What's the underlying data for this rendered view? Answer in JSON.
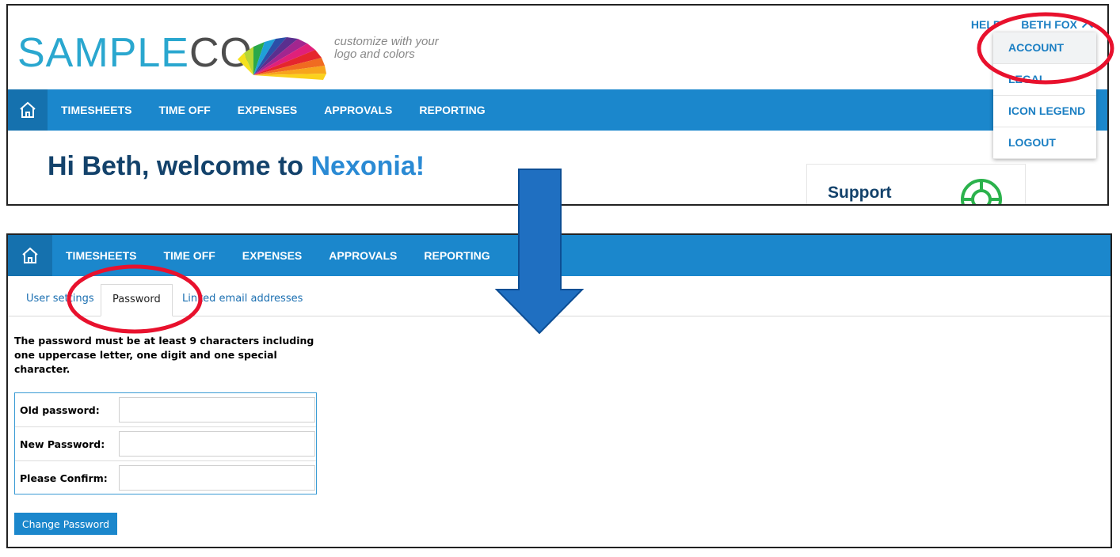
{
  "top_screen": {
    "logo": {
      "part1": "SAMPLE",
      "part2": "CO"
    },
    "tagline": "customize with your logo and colors",
    "header_links": {
      "help": "HELP",
      "user": "BETH FOX"
    },
    "nav": [
      "TIMESHEETS",
      "TIME OFF",
      "EXPENSES",
      "APPROVALS",
      "REPORTING"
    ],
    "welcome": {
      "prefix": "Hi Beth, welcome to ",
      "brand": "Nexonia!"
    },
    "support": {
      "title": "Support"
    },
    "dropdown": [
      "ACCOUNT",
      "LEGAL",
      "ICON LEGEND",
      "LOGOUT"
    ]
  },
  "bottom_screen": {
    "nav": [
      "TIMESHEETS",
      "TIME OFF",
      "EXPENSES",
      "APPROVALS",
      "REPORTING"
    ],
    "tabs": [
      "User settings",
      "Password",
      "Linked email addresses"
    ],
    "hint": "The password must be at least 9 characters including one uppercase letter, one digit and one special character.",
    "fields": [
      {
        "label": "Old password:",
        "value": ""
      },
      {
        "label": "New Password:",
        "value": ""
      },
      {
        "label": "Please Confirm:",
        "value": ""
      }
    ],
    "button": "Change Password"
  },
  "colors": {
    "nav_blue": "#1b87cc",
    "home_blue": "#1571ae",
    "link_blue": "#1b7fc3",
    "highlight_red": "#e8112d",
    "arrow_blue": "#1f6fc1"
  }
}
